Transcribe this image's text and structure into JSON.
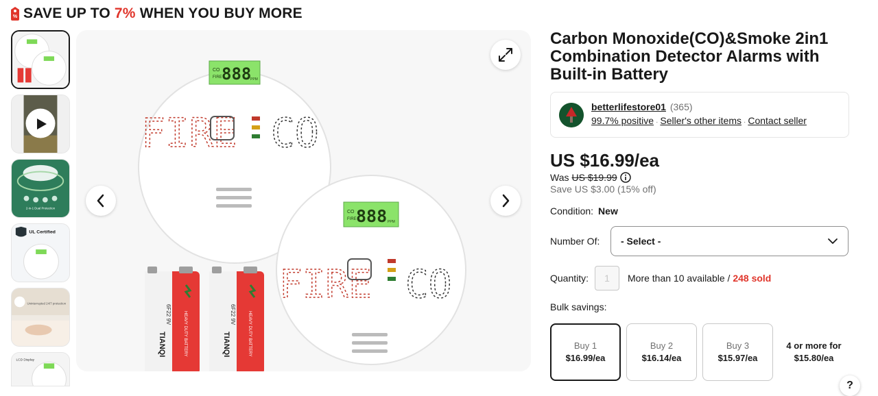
{
  "promo": {
    "prefix": "SAVE UP TO",
    "percent": "7%",
    "suffix": "WHEN YOU BUY MORE",
    "accent_color": "#e0352b"
  },
  "gallery": {
    "thumb_count": 6,
    "active_thumb": 0,
    "main_image": {
      "device_text": "FIRE",
      "device_text_2": "CO",
      "display_digits": "888",
      "display_unit": "PPM",
      "display_co": "CO",
      "display_fire": "FIRE",
      "battery_label": "6F22 9V",
      "battery_brand": "TIANQI",
      "battery_sub": "HEAVY DUTY BATTERY"
    },
    "thumb_texts": {
      "dual": "2-in-1 Dual Protection",
      "ul": "UL Certified",
      "uninterrupted": "Uninterrupted 24/7 protection",
      "lcd": "LCD Display"
    }
  },
  "product": {
    "title": "Carbon Monoxide(CO)&Smoke 2in1 Combination Detector Alarms with Built-in Battery"
  },
  "seller": {
    "name": "betterlifestore01",
    "feedback_count": "(365)",
    "positive": "99.7% positive",
    "other_items": "Seller's other items",
    "contact": "Contact seller"
  },
  "pricing": {
    "price": "US $16.99/ea",
    "was_label": "Was",
    "was_price": "US $19.99",
    "save_text": "Save US $3.00 (15% off)"
  },
  "condition": {
    "label": "Condition:",
    "value": "New"
  },
  "number_of": {
    "label": "Number Of:",
    "selected": "- Select -"
  },
  "quantity": {
    "label": "Quantity:",
    "placeholder": "1",
    "available": "More than 10 available / ",
    "sold": "248 sold"
  },
  "bulk": {
    "label": "Bulk savings:",
    "tiers": [
      {
        "qty": "Buy 1",
        "price": "$16.99/ea"
      },
      {
        "qty": "Buy 2",
        "price": "$16.14/ea"
      },
      {
        "qty": "Buy 3",
        "price": "$15.97/ea"
      },
      {
        "qty": "4 or more for",
        "price": "$15.80/ea"
      }
    ]
  },
  "help": {
    "label": "?"
  },
  "icons": {
    "promo": "price-tag-icon",
    "expand": "expand-icon",
    "prev": "chevron-left-icon",
    "next": "chevron-right-icon",
    "info": "info-icon",
    "dropdown": "chevron-down-icon",
    "play": "play-icon"
  }
}
